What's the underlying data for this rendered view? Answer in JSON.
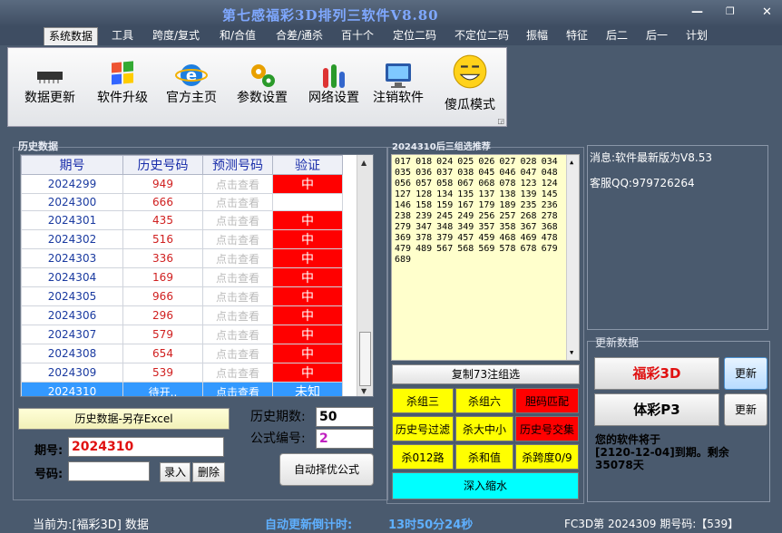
{
  "window": {
    "title": "第七感福彩3D排列三软件V8.80",
    "minimize": "—",
    "restore": "❐",
    "close": "✕"
  },
  "menu": [
    "系统数据",
    "工具",
    "跨度/复式",
    "和/合值",
    "合差/通杀",
    "百十个",
    "定位二码",
    "不定位二码",
    "振幅",
    "特征",
    "后二",
    "后一",
    "计划"
  ],
  "toolbar": [
    {
      "label": "数据更新",
      "icon": "chip-icon"
    },
    {
      "label": "软件升级",
      "icon": "windows-icon"
    },
    {
      "label": "官方主页",
      "icon": "ie-icon"
    },
    {
      "label": "参数设置",
      "icon": "gears-icon"
    },
    {
      "label": "网络设置",
      "icon": "network-icon"
    },
    {
      "label": "注销软件",
      "icon": "monitor-icon"
    },
    {
      "label": "傻瓜模式",
      "icon": "smiley-icon"
    }
  ],
  "history": {
    "panel_title": "历史数据",
    "headers": [
      "期号",
      "历史号码",
      "预测号码",
      "验证"
    ],
    "rows": [
      {
        "issue": "2024299",
        "number": "949",
        "predict": "点击查看",
        "verify": "中"
      },
      {
        "issue": "2024300",
        "number": "666",
        "predict": "点击查看",
        "verify": ""
      },
      {
        "issue": "2024301",
        "number": "435",
        "predict": "点击查看",
        "verify": "中"
      },
      {
        "issue": "2024302",
        "number": "516",
        "predict": "点击查看",
        "verify": "中"
      },
      {
        "issue": "2024303",
        "number": "336",
        "predict": "点击查看",
        "verify": "中"
      },
      {
        "issue": "2024304",
        "number": "169",
        "predict": "点击查看",
        "verify": "中"
      },
      {
        "issue": "2024305",
        "number": "966",
        "predict": "点击查看",
        "verify": "中"
      },
      {
        "issue": "2024306",
        "number": "296",
        "predict": "点击查看",
        "verify": "中"
      },
      {
        "issue": "2024307",
        "number": "579",
        "predict": "点击查看",
        "verify": "中"
      },
      {
        "issue": "2024308",
        "number": "654",
        "predict": "点击查看",
        "verify": "中"
      },
      {
        "issue": "2024309",
        "number": "539",
        "predict": "点击查看",
        "verify": "中"
      }
    ],
    "selected_row": {
      "issue": "2024310",
      "number": "待开..",
      "predict": "点击查看",
      "verify": "未知"
    },
    "export_button": "历史数据-另存Excel",
    "periods_label": "历史期数:",
    "periods_value": "50",
    "formula_label": "公式编号:",
    "formula_value": "2",
    "issue_label": "期号:",
    "issue_value": "2024310",
    "code_label": "号码:",
    "code_value": "",
    "enter_button": "录入",
    "delete_button": "删除",
    "auto_button": "自动择优公式"
  },
  "recommend": {
    "panel_title": "2024310后三组选推荐",
    "numbers": "017 018 024 025 026 027 028 034 035 036 037 038 045 046 047 048 056 057 058 067 068 078 123 124 127 128 134 135 137 138 139 145 146 158 159 167 179 189 235 236 238 239 245 249 256 257 268 278 279 347 348 349 357 358 367 368 369 378 379 457 459 468 469 478 479 489 567 568 569 578 678 679 689",
    "copy_button": "复制73注组选",
    "buttons": [
      {
        "label": "杀组三",
        "color": "yellow"
      },
      {
        "label": "杀组六",
        "color": "yellow"
      },
      {
        "label": "胆码匹配",
        "color": "red"
      },
      {
        "label": "历史号过滤",
        "color": "yellow"
      },
      {
        "label": "杀大中小",
        "color": "yellow"
      },
      {
        "label": "历史号交集",
        "color": "red"
      },
      {
        "label": "杀012路",
        "color": "yellow"
      },
      {
        "label": "杀和值",
        "color": "yellow"
      },
      {
        "label": "杀跨度0/9",
        "color": "yellow"
      }
    ],
    "deep_button": "深入缩水"
  },
  "messages": {
    "line1": "消息:软件最新版为V8.53",
    "line2": "客服QQ:979726264"
  },
  "update": {
    "panel_title": "更新数据",
    "fc3d": "福彩3D",
    "p3": "体彩P3",
    "update_button": "更新",
    "expire_line1": "您的软件将于",
    "expire_line2": "[2120-12-04]到期。剩余",
    "expire_line3": "35078天"
  },
  "status": {
    "current": "当前为:[福彩3D] 数据",
    "countdown_label": "自动更新倒计时:",
    "countdown_value": "13时50分24秒",
    "period_info": "FC3D第 2024309 期号码:【539】"
  },
  "colors": {
    "accent_red": "#ff0000",
    "accent_yellow": "#ffff00",
    "accent_cyan": "#00ffff",
    "select_blue": "#3399ff",
    "title_blue": "#7fa8ff"
  }
}
